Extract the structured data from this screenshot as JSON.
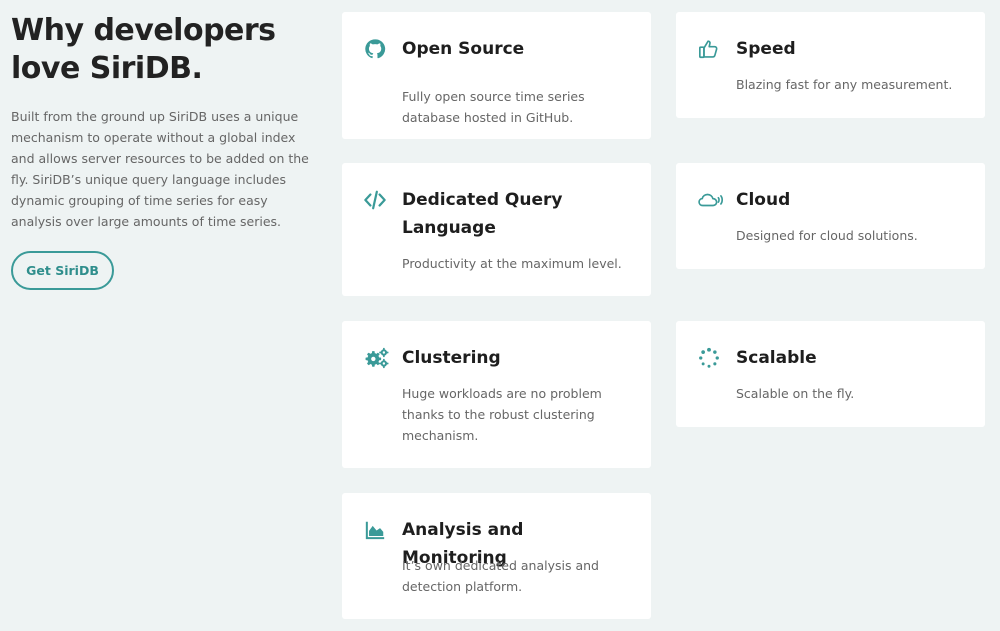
{
  "intro": {
    "title": "Why developers love SiriDB.",
    "body": "Built from the ground up SiriDB uses a unique mechanism to operate without a global index and allows server resources to be added on the fly. SiriDB’s unique query language includes dynamic grouping of time series for easy analysis over large amounts of time series.",
    "cta_label": "Get SiriDB"
  },
  "features": [
    {
      "icon": "github-icon",
      "title": "Open Source",
      "description": "Fully open source time series database hosted in GitHub."
    },
    {
      "icon": "thumbs-up-icon",
      "title": "Speed",
      "description": "Blazing fast for any measurement."
    },
    {
      "icon": "code-icon",
      "title": "Dedicated Query Language",
      "description": "Productivity at the maximum level."
    },
    {
      "icon": "cloud-icon",
      "title": "Cloud",
      "description": "Designed for cloud solutions."
    },
    {
      "icon": "cogs-icon",
      "title": "Clustering",
      "description": "Huge workloads are no problem thanks to the robust clustering mechanism."
    },
    {
      "icon": "spinner-icon",
      "title": "Scalable",
      "description": "Scalable on the fly."
    },
    {
      "icon": "area-chart-icon",
      "title": "Analysis and Monitoring",
      "description": "It’s own dedicated analysis and detection platform."
    }
  ],
  "colors": {
    "accent": "#3a9a98",
    "background": "#eef3f3",
    "card": "#ffffff"
  }
}
